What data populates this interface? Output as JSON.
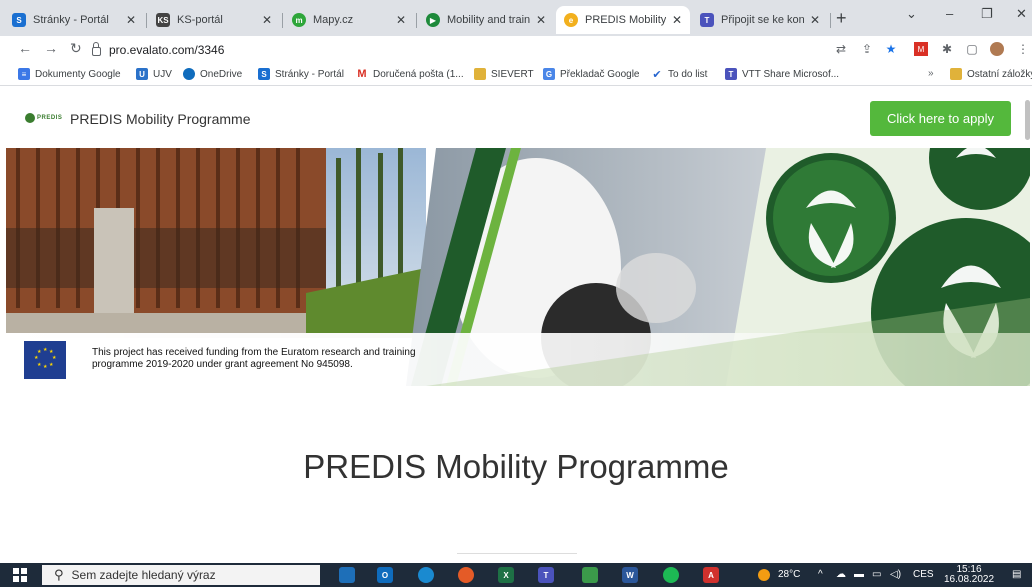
{
  "tabs": [
    {
      "label": "Stránky - Portál",
      "icon": "sharepoint-icon",
      "color": "#1a6fd1"
    },
    {
      "label": "KS-portál",
      "icon": "ks-portal-icon",
      "color": "#444"
    },
    {
      "label": "Mapy.cz",
      "icon": "mapy-icon",
      "color": "#2ea63a"
    },
    {
      "label": "Mobility and traini",
      "icon": "play-icon",
      "color": "#1e8a3b"
    },
    {
      "label": "PREDIS Mobility Pr",
      "icon": "evalato-icon",
      "color": "#f2b01e"
    },
    {
      "label": "Připojit se ke konve",
      "icon": "teams-icon",
      "color": "#4b53bc"
    }
  ],
  "address": {
    "url": "pro.evalato.com/3346"
  },
  "bookmarks": [
    {
      "label": "Dokumenty Google",
      "icon": "google-docs-icon",
      "color": "#3b78e7"
    },
    {
      "label": "UJV",
      "icon": "ujv-icon",
      "color": "#2b72c9"
    },
    {
      "label": "OneDrive",
      "icon": "onedrive-icon",
      "color": "#0f6cbd"
    },
    {
      "label": "Stránky - Portál",
      "icon": "sharepoint-icon",
      "color": "#1a6fd1"
    },
    {
      "label": "Doručená pošta (1...",
      "icon": "gmail-icon",
      "color": "#d93025"
    },
    {
      "label": "SIEVERT",
      "icon": "folder-icon",
      "color": "#e0b23a"
    },
    {
      "label": "Překladač Google",
      "icon": "translate-icon",
      "color": "#4a86e8"
    },
    {
      "label": "To do list",
      "icon": "check-icon",
      "color": "#2564cf"
    },
    {
      "label": "VTT Share Microsof...",
      "icon": "teams-icon",
      "color": "#4b53bc"
    },
    {
      "label": "Ostatní záložky",
      "icon": "folder-icon",
      "color": "#e0b23a"
    }
  ],
  "bookmarks_more": "»",
  "header": {
    "logo_text": "PREDIS",
    "brand": "PREDIS Mobility Programme",
    "apply_label": "Click here to apply"
  },
  "funding": {
    "text": "This project has received funding from the Euratom research and training programme 2019-2020 under grant agreement No 945098."
  },
  "main": {
    "title": "PREDIS Mobility Programme"
  },
  "taskbar": {
    "search_placeholder": "Sem zadejte hledaný výraz",
    "weather": "28°C",
    "lang": "CES",
    "time": "15:16",
    "date": "16.08.2022"
  },
  "colors": {
    "accent_green": "#54b83c",
    "dark_green": "#1f5b2a"
  }
}
